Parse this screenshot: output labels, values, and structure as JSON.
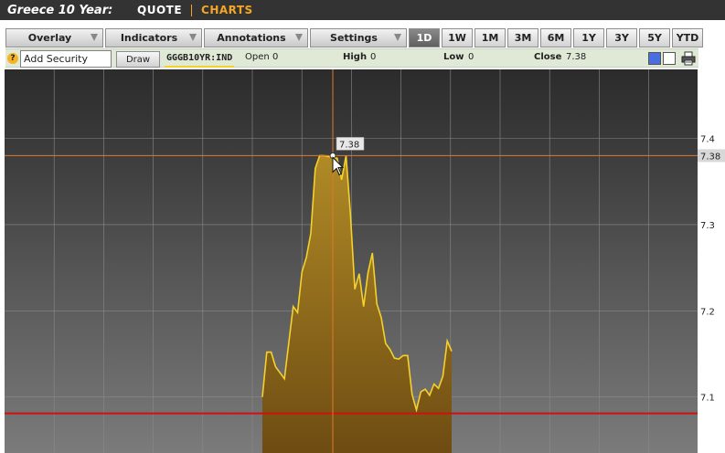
{
  "header": {
    "title": "Greece 10 Year:",
    "nav_quote": "QUOTE",
    "nav_charts": "CHARTS"
  },
  "toolbar": {
    "overlay": "Overlay",
    "indicators": "Indicators",
    "annotations": "Annotations",
    "settings": "Settings",
    "ranges": [
      "1D",
      "1W",
      "1M",
      "3M",
      "6M",
      "1Y",
      "3Y",
      "5Y",
      "YTD"
    ],
    "active_range": "1D"
  },
  "security_bar": {
    "add_security_value": "Add Security",
    "draw_label": "Draw",
    "ticker": "GGGB10YR:IND",
    "open_label": "Open",
    "open_value": "0",
    "high_label": "High",
    "high_value": "0",
    "low_label": "Low",
    "low_value": "0",
    "close_label": "Close",
    "close_value": "7.38"
  },
  "colors": {
    "line": "#f5d12a",
    "fill_top": "#b08a26",
    "fill_bottom": "#6e4c12",
    "crosshair": "#e07a2a",
    "reference_line": "#d01010",
    "accent": "#f5a623"
  },
  "chart_data": {
    "type": "area",
    "x": [
      0,
      1,
      2,
      3,
      4,
      5,
      6,
      7,
      8,
      9,
      10,
      11,
      12,
      13,
      14,
      15,
      16,
      17,
      18,
      19,
      20,
      21,
      22,
      23,
      24,
      25,
      26,
      27,
      28,
      29,
      30,
      31,
      32,
      33,
      34,
      35,
      36,
      37,
      38,
      39,
      40,
      41,
      42,
      43,
      44,
      45,
      46
    ],
    "values": [
      7.1,
      7.152,
      7.152,
      7.135,
      7.128,
      7.121,
      7.163,
      7.205,
      7.198,
      7.245,
      7.262,
      7.29,
      7.365,
      7.38,
      7.38,
      7.379,
      7.378,
      7.377,
      7.352,
      7.38,
      7.312,
      7.225,
      7.243,
      7.205,
      7.244,
      7.267,
      7.208,
      7.192,
      7.162,
      7.155,
      7.145,
      7.144,
      7.148,
      7.148,
      7.103,
      7.085,
      7.106,
      7.109,
      7.102,
      7.115,
      7.11,
      7.124,
      7.165,
      7.153
    ],
    "yticks": [
      7.1,
      7.2,
      7.3,
      7.4
    ],
    "ylim": [
      7.035,
      7.48
    ],
    "x_max": 100,
    "reference_value": 7.081,
    "crosshair_value": 7.38,
    "crosshair_label": "7.38",
    "last_value_label": "7.38"
  }
}
